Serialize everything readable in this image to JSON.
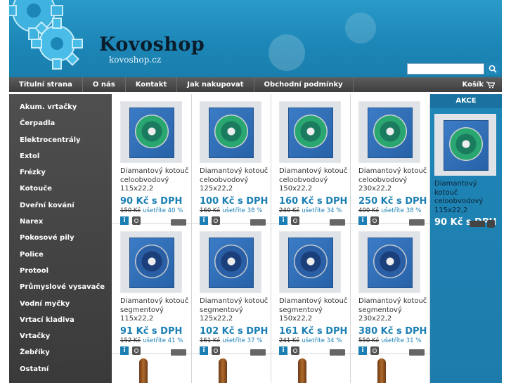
{
  "header": {
    "logo": "Kovoshop",
    "logo_sub": "kovoshop.cz",
    "search_placeholder": ""
  },
  "menu": [
    "Titulní strana",
    "O nás",
    "Kontakt",
    "Jak nakupovat",
    "Obchodní podmínky"
  ],
  "cart_label": "Košík",
  "sidebar": [
    "Akum. vrtačky",
    "Čerpadla",
    "Elektrocentrály",
    "Extol",
    "Frézky",
    "Kotouče",
    "Dveřní kování",
    "Narex",
    "Pokosové pily",
    "Police",
    "Protool",
    "Průmyslové vysavače",
    "Vodní myčky",
    "Vrtací kladiva",
    "Vrtačky",
    "Žebříky",
    "Ostatní"
  ],
  "products": [
    {
      "name": "Diamantový kotouč celoobvodový 115x22,2",
      "price": "90 Kč s DPH",
      "old": "150 Kč",
      "save": "ušetříte 40 %"
    },
    {
      "name": "Diamantový kotouč celoobvodový 125x22,2",
      "price": "100 Kč s DPH",
      "old": "160 Kč",
      "save": "ušetříte 38 %"
    },
    {
      "name": "Diamantový kotouč celoobvodový 150x22,2",
      "price": "160 Kč s DPH",
      "old": "240 Kč",
      "save": "ušetříte 34 %"
    },
    {
      "name": "Diamantový kotouč celoobvodový 230x22,2",
      "price": "250 Kč s DPH",
      "old": "400 Kč",
      "save": "ušetříte 38 %"
    },
    {
      "name": "Diamantový kotouč segmentový 115x22,2",
      "price": "91 Kč s DPH",
      "old": "152 Kč",
      "save": "ušetříte 41 %"
    },
    {
      "name": "Diamantový kotouč segmentový 125x22,2",
      "price": "102 Kč s DPH",
      "old": "161 Kč",
      "save": "ušetříte 37 %"
    },
    {
      "name": "Diamantový kotouč segmentový 150x22,2",
      "price": "161 Kč s DPH",
      "old": "241 Kč",
      "save": "ušetříte 34 %"
    },
    {
      "name": "Diamantový kotouč segmentový 230x22,2",
      "price": "380 Kč s DPH",
      "old": "550 Kč",
      "save": "ušetříte 31 %"
    }
  ],
  "akce": {
    "title": "AKCE",
    "name": "Diamantový kotouč celoobvodový 115x22,2",
    "price": "90 Kč s DPH"
  },
  "info_icon": "i"
}
